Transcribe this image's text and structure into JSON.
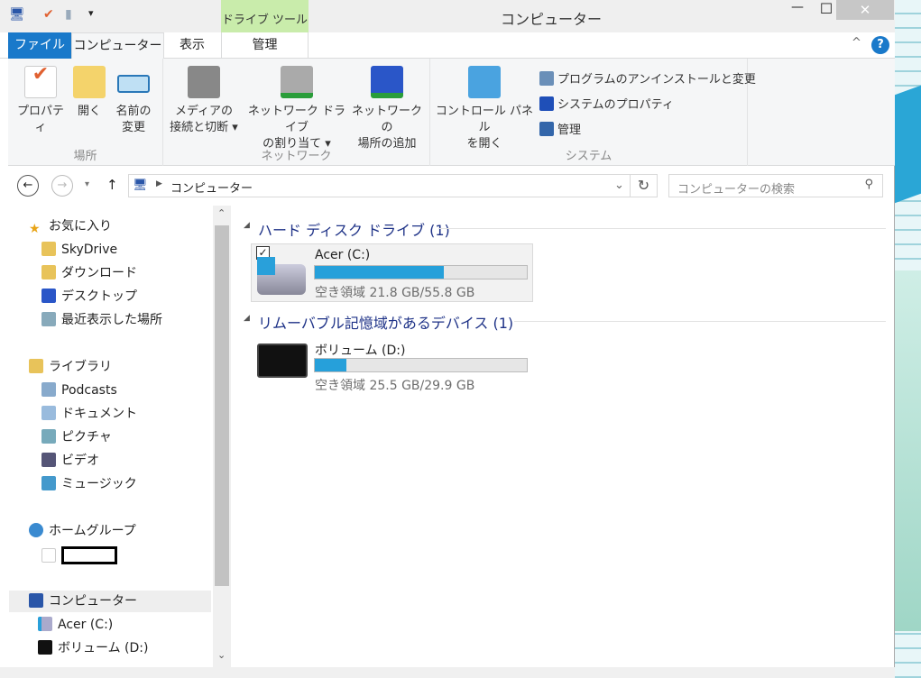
{
  "window": {
    "title": "コンピューター",
    "context_tab_group": "ドライブ ツール",
    "minimize": "—",
    "maximize": "☐",
    "close": "✕"
  },
  "quick_access": {
    "dropdown": "▾"
  },
  "tabs": [
    {
      "label": "ファイル"
    },
    {
      "label": "コンピューター"
    },
    {
      "label": "表示"
    },
    {
      "label": "管理"
    }
  ],
  "ribbon": {
    "groups": [
      {
        "label": "場所",
        "buttons": [
          "プロパティ",
          "開く",
          "名前の\n変更"
        ]
      },
      {
        "label": "ネットワーク",
        "buttons": [
          "メディアの\n接続と切断 ▾",
          "ネットワーク ドライブ\nの割り当て ▾",
          "ネットワークの\n場所の追加"
        ]
      },
      {
        "label": "システム",
        "buttons": [
          "コントロール パネル\nを開く"
        ],
        "small": [
          "プログラムのアンインストールと変更",
          "システムのプロパティ",
          "管理"
        ]
      }
    ]
  },
  "address": {
    "path": "コンピューター",
    "search_placeholder": "コンピューターの検索"
  },
  "nav": {
    "favorites": {
      "label": "お気に入り",
      "items": [
        "SkyDrive",
        "ダウンロード",
        "デスクトップ",
        "最近表示した場所"
      ]
    },
    "libraries": {
      "label": "ライブラリ",
      "items": [
        "Podcasts",
        "ドキュメント",
        "ピクチャ",
        "ビデオ",
        "ミュージック"
      ]
    },
    "homegroup": {
      "label": "ホームグループ"
    },
    "computer": {
      "label": "コンピューター",
      "items": [
        "Acer (C:)",
        "ボリューム (D:)"
      ]
    }
  },
  "main": {
    "groups": [
      {
        "header": "ハード ディスク ドライブ (1)",
        "drives": [
          {
            "name": "Acer (C:)",
            "free": "空き領域 21.8 GB/55.8 GB",
            "used_fraction": 0.61,
            "selected": true
          }
        ]
      },
      {
        "header": "リムーバブル記憶域があるデバイス (1)",
        "drives": [
          {
            "name": "ボリューム (D:)",
            "free": "空き領域 25.5 GB/29.9 GB",
            "used_fraction": 0.15
          }
        ]
      }
    ]
  },
  "colors": {
    "accent": "#1979ca",
    "bar": "#26a0da",
    "context_tab": "#c9ecab",
    "group_header": "#1e3287"
  }
}
